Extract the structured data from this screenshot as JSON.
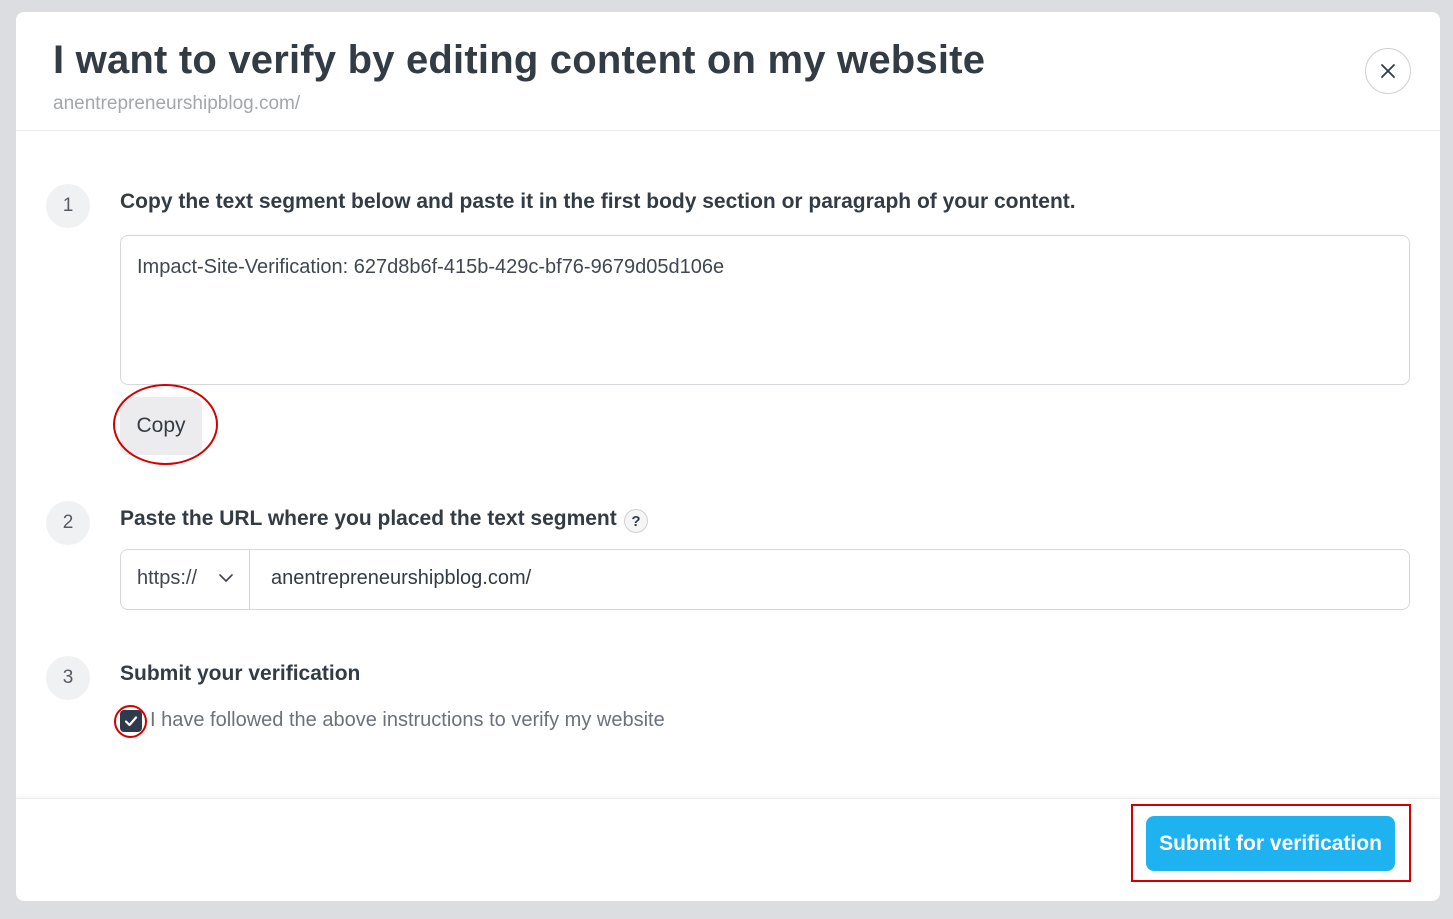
{
  "modal": {
    "title": "I want to verify by editing content on my website",
    "subtitle": "anentrepreneurshipblog.com/",
    "close_icon": "close-icon"
  },
  "steps": [
    {
      "number": "1",
      "title": "Copy the text segment below and paste it in the first body section or paragraph of your content.",
      "code_text": "Impact-Site-Verification: 627d8b6f-415b-429c-bf76-9679d05d106e",
      "copy_label": "Copy"
    },
    {
      "number": "2",
      "title": "Paste the URL where you placed the text segment",
      "help_label": "?",
      "protocol": "https://",
      "url_value": "anentrepreneurshipblog.com/"
    },
    {
      "number": "3",
      "title": "Submit your verification",
      "checkbox_label": "I have followed the above instructions to verify my website",
      "checked": true
    }
  ],
  "footer": {
    "submit_label": "Submit for verification"
  },
  "colors": {
    "primary_button": "#1eb3f0",
    "annotation_red": "#d40000",
    "checkbox_fill": "#2f3b4b"
  }
}
